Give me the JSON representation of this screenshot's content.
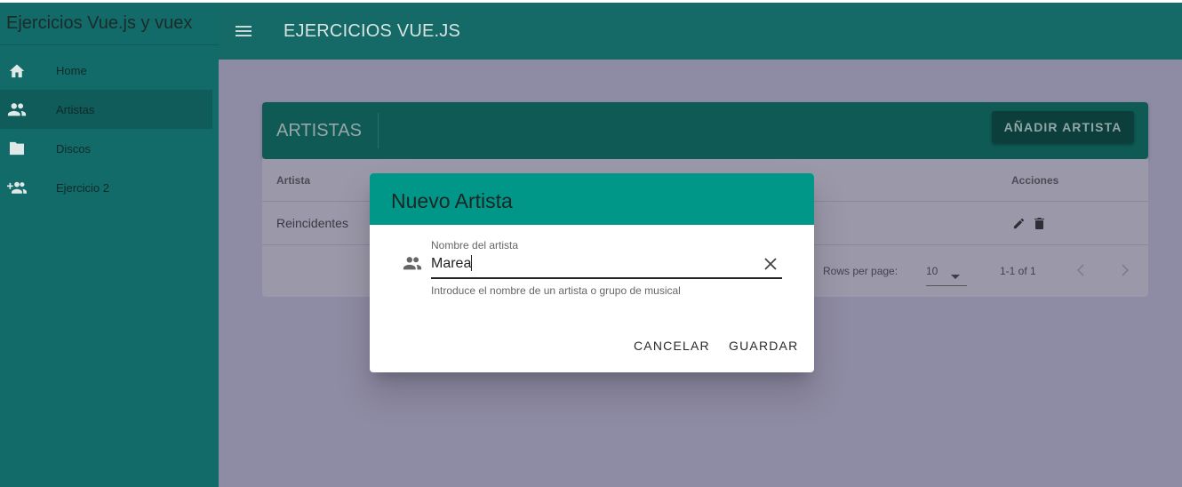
{
  "sidebar": {
    "title": "Ejercicios Vue.js y vuex",
    "items": [
      {
        "label": "Home",
        "icon": "home-icon"
      },
      {
        "label": "Artistas",
        "icon": "people-icon"
      },
      {
        "label": "Discos",
        "icon": "folder-icon"
      },
      {
        "label": "Ejercicio 2",
        "icon": "add-people-icon"
      }
    ]
  },
  "appbar": {
    "title": "EJERCICIOS VUE.JS"
  },
  "card": {
    "title": "ARTISTAS",
    "add_button": "AÑADIR ARTISTA",
    "columns": [
      "Artista",
      "Acciones"
    ],
    "rows": [
      {
        "artista": "Reincidentes"
      }
    ],
    "footer": {
      "rows_per_page_label": "Rows per page:",
      "rows_per_page_value": "10",
      "range": "1-1 of 1"
    }
  },
  "dialog": {
    "title": "Nuevo Artista",
    "field_label": "Nombre del artista",
    "field_value": "Marea",
    "field_hint": "Introduce el nombre de un artista o grupo de musical",
    "cancel": "CANCELAR",
    "save": "GUARDAR"
  },
  "colors": {
    "sidebar": "#136b69",
    "appbar": "#156966",
    "dialog_header": "#009688",
    "overlay": "#8e8ba4"
  }
}
